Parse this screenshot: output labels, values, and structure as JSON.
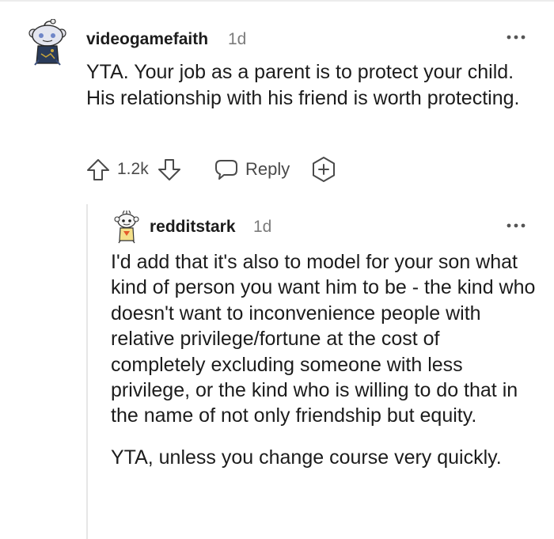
{
  "comment": {
    "username": "videogamefaith",
    "time": "1d",
    "body": "YTA. Your job as a parent is to protect your child. His relationship with his friend is worth protecting.",
    "actions": {
      "score": "1.2k",
      "reply_label": "Reply"
    }
  },
  "reply": {
    "username": "redditstark",
    "time": "1d",
    "paragraphs": [
      "I'd add that it's also to model for your son what kind of person you want him to be - the kind who doesn't want to inconvenience people with relative privilege/fortune at the cost of completely excluding someone with less privilege, or the kind who is willing to do that in the name of not only friendship but equity.",
      "YTA, unless you change course very quickly."
    ]
  },
  "icons": {
    "more": "more-options-icon",
    "upvote": "upvote-arrow-icon",
    "downvote": "downvote-arrow-icon",
    "reply": "speech-bubble-icon",
    "award": "award-plus-icon"
  },
  "colors": {
    "text": "#1c1c1c",
    "meta": "#7c7c7c",
    "action": "#4a4a4a",
    "thread_line": "#e6e6e6"
  }
}
